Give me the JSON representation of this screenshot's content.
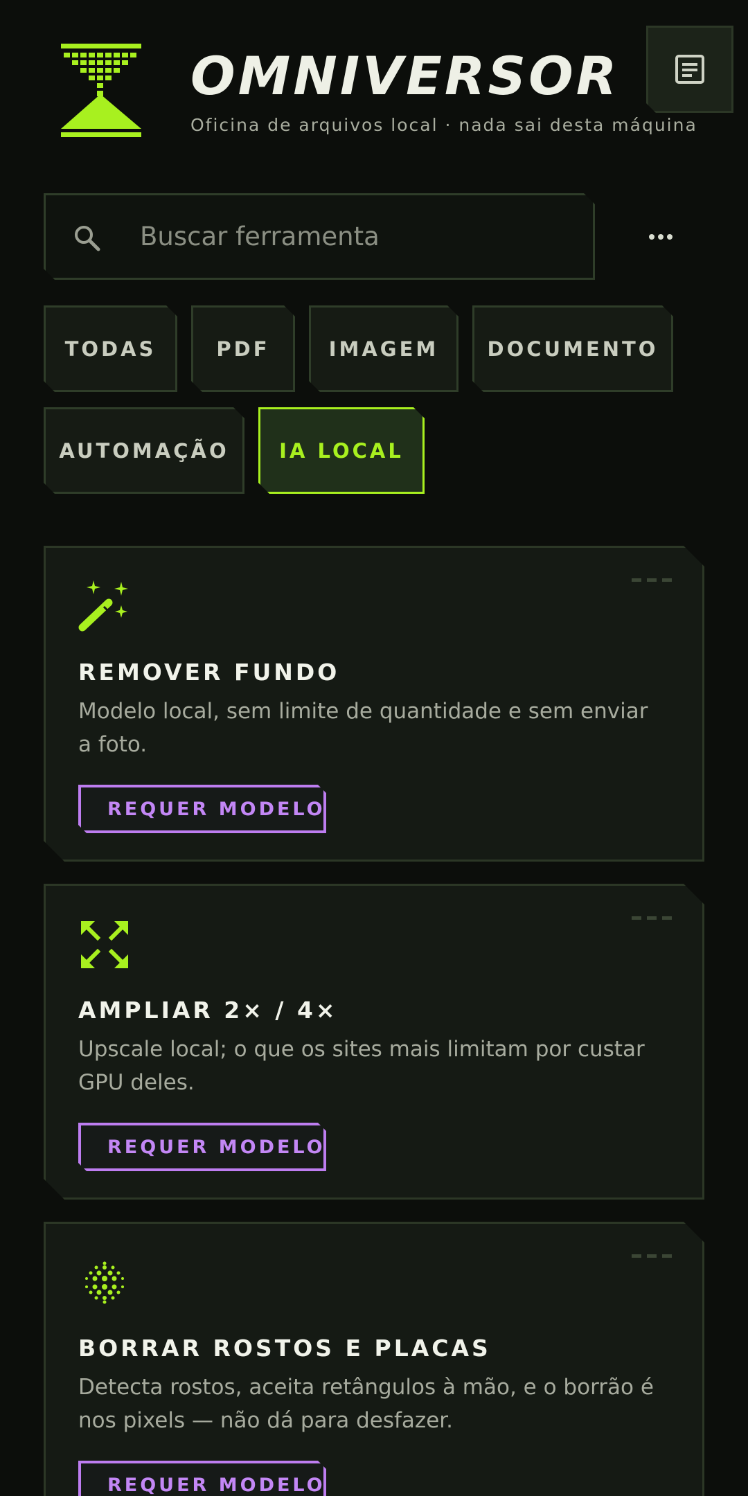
{
  "header": {
    "title": "OMNIVERSOR",
    "subtitle": "Oficina de arquivos local · nada sai desta máquina",
    "logo_icon": "hourglass-icon",
    "doc_button_icon": "document-icon"
  },
  "search": {
    "placeholder": "Buscar ferramenta",
    "value": "",
    "icon": "search-icon",
    "more_icon": "more-horizontal-icon"
  },
  "filters": {
    "active": "IA LOCAL",
    "items": [
      {
        "label": "TODAS"
      },
      {
        "label": "PDF"
      },
      {
        "label": "IMAGEM"
      },
      {
        "label": "DOCUMENTO"
      },
      {
        "label": "AUTOMAÇÃO"
      },
      {
        "label": "IA LOCAL"
      }
    ]
  },
  "tools": [
    {
      "icon": "magic-wand-icon",
      "title": "REMOVER FUNDO",
      "description": "Modelo local, sem limite de quantidade e sem enviar a foto.",
      "badge_icon": "sparkle-icon",
      "badge_label": "REQUER MODELO"
    },
    {
      "icon": "expand-icon",
      "title": "AMPLIAR 2× / 4×",
      "description": "Upscale local; o que os sites mais limitam por custar GPU deles.",
      "badge_icon": "sparkle-icon",
      "badge_label": "REQUER MODELO"
    },
    {
      "icon": "blur-dots-icon",
      "title": "BORRAR ROSTOS E PLACAS",
      "description": "Detecta rostos, aceita retângulos à mão, e o borrão é nos pixels — não dá para desfazer.",
      "badge_icon": "sparkle-icon",
      "badge_label": "REQUER MODELO"
    }
  ],
  "colors": {
    "background": "#0c0e0b",
    "accent": "#a8f01f",
    "badge": "#bd7df0",
    "border": "#2c3726"
  }
}
